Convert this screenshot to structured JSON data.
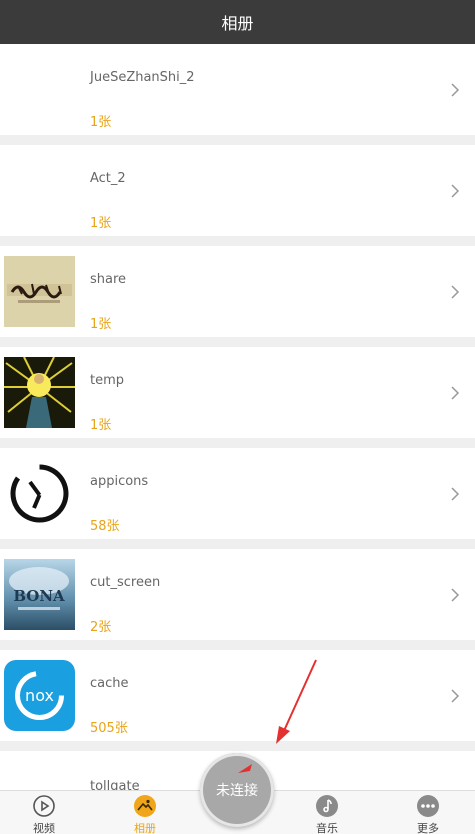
{
  "header": {
    "title": "相册"
  },
  "albums": [
    {
      "name": "JueSeZhanShi_2",
      "count": "1张",
      "thumb": "none"
    },
    {
      "name": "Act_2",
      "count": "1张",
      "thumb": "none"
    },
    {
      "name": "share",
      "count": "1张",
      "thumb": "calligraphy-image"
    },
    {
      "name": "temp",
      "count": "1张",
      "thumb": "glowing-figure-image"
    },
    {
      "name": "appicons",
      "count": "58张",
      "thumb": "clock-icon-image"
    },
    {
      "name": "cut_screen",
      "count": "2张",
      "thumb": "game-splash-image"
    },
    {
      "name": "cache",
      "count": "505张",
      "thumb": "nox-app-icon"
    },
    {
      "name": "tollgate",
      "count": "",
      "thumb": "none"
    }
  ],
  "tabs": [
    {
      "label": "视频",
      "icon": "play-circle-icon"
    },
    {
      "label": "相册",
      "icon": "photo-album-icon",
      "active": true
    },
    {
      "label": "音乐",
      "icon": "music-note-icon"
    },
    {
      "label": "更多",
      "icon": "more-dots-icon"
    }
  ],
  "connect": {
    "label": "未连接"
  },
  "colors": {
    "header_bg": "#3b3b3b",
    "accent": "#e8a418",
    "background": "#efefef"
  }
}
